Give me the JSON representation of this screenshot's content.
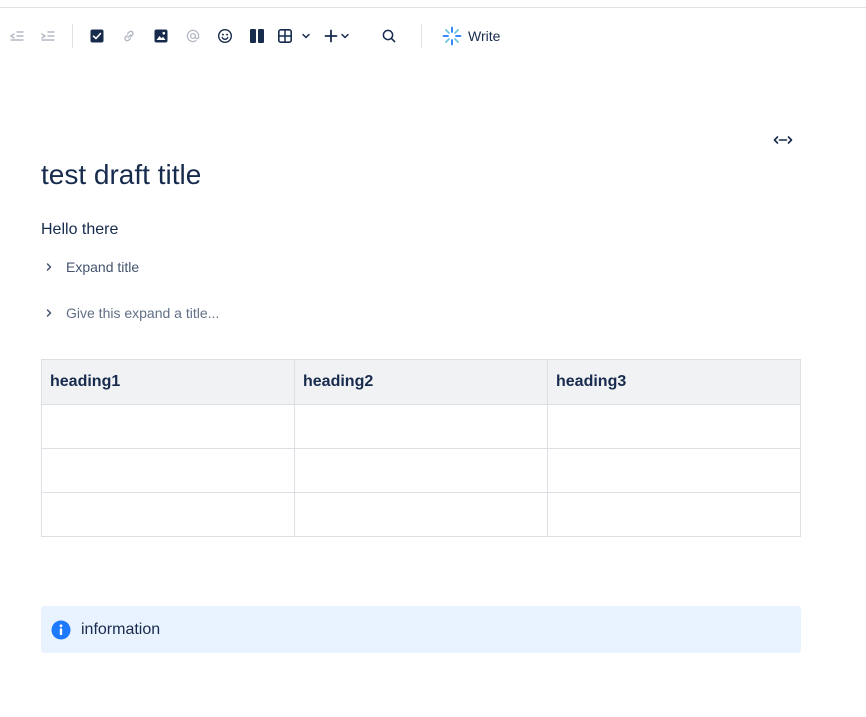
{
  "toolbar": {
    "icons": [
      {
        "name": "outdent-icon",
        "enabled": false
      },
      {
        "name": "indent-icon",
        "enabled": false
      },
      {
        "name": "action-item-icon",
        "enabled": true
      },
      {
        "name": "link-icon",
        "enabled": false
      },
      {
        "name": "image-icon",
        "enabled": true
      },
      {
        "name": "mention-icon",
        "enabled": false
      },
      {
        "name": "emoji-icon",
        "enabled": true
      },
      {
        "name": "layouts-icon",
        "enabled": true
      },
      {
        "name": "table-icon",
        "enabled": true
      },
      {
        "name": "insert-icon",
        "enabled": true
      },
      {
        "name": "search-icon",
        "enabled": true
      }
    ],
    "write_label": "Write"
  },
  "document": {
    "title": "test draft title",
    "paragraph": "Hello there",
    "expands": [
      {
        "title": "Expand title",
        "is_placeholder": false
      },
      {
        "title": "Give this expand a title...",
        "is_placeholder": true
      }
    ],
    "table": {
      "headers": [
        "heading1",
        "heading2",
        "heading3"
      ],
      "rows": [
        [
          "",
          "",
          ""
        ],
        [
          "",
          "",
          ""
        ],
        [
          "",
          "",
          ""
        ]
      ]
    },
    "info_panel": {
      "text": "information",
      "icon": "info-icon"
    }
  },
  "colors": {
    "text": "#172b4d",
    "muted_icon": "#a5adba",
    "info_blue": "#1d7afc",
    "table_header_bg": "#f1f2f4",
    "info_bg": "#e9f2ff",
    "border": "#dcdfe4"
  }
}
